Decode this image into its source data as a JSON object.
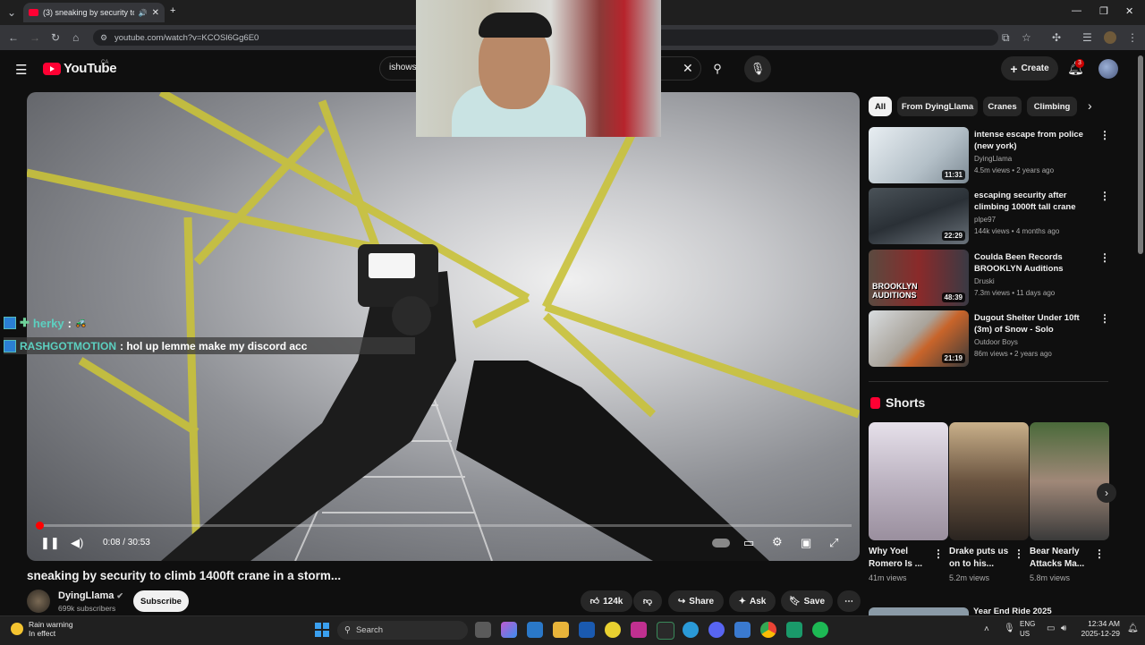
{
  "browser": {
    "tab_title": "(3) sneaking by security to",
    "url": "youtube.com/watch?v=KCOSl6Gg6E0"
  },
  "header": {
    "logo_text": "YouTube",
    "country_code": "CA",
    "search_value": "ishows",
    "create_label": "Create",
    "notification_count": "3"
  },
  "chat": {
    "line1_user": "herky",
    "line1_sep": ":",
    "line2_user": "RASHGOTMOTION",
    "line2_text": ": hol up lemme make my discord acc"
  },
  "player": {
    "time": "0:08 / 30:53",
    "progress_fraction": 0.004
  },
  "video": {
    "title": "sneaking by security to climb 1400ft crane in a storm...",
    "channel": "DyingLlama",
    "subscribers": "699k subscribers",
    "subscribe_label": "Subscribe",
    "likes": "124k",
    "share_label": "Share",
    "ask_label": "Ask",
    "save_label": "Save"
  },
  "chips": [
    "All",
    "From DyingLlama",
    "Cranes",
    "Climbing"
  ],
  "related": [
    {
      "title": "intense escape from police (new york)",
      "channel": "DyingLlama",
      "meta": "4.5m views • 2 years ago",
      "duration": "11:31"
    },
    {
      "title": "escaping security after climbing 1000ft tall crane (toronto)",
      "channel": "plpe97",
      "meta": "144k views • 4 months ago",
      "duration": "22:29"
    },
    {
      "title": "Coulda Been Records BROOKLYN Auditions hosted b...",
      "channel": "Druski",
      "meta": "7.3m views • 11 days ago",
      "duration": "48:39",
      "thumb_text": "BROOKLYN AUDITIONS"
    },
    {
      "title": "Dugout Shelter Under 10ft (3m) of Snow - Solo Camping in ...",
      "channel": "Outdoor Boys",
      "meta": "86m views • 2 years ago",
      "duration": "21:19"
    }
  ],
  "shorts": {
    "heading": "Shorts",
    "items": [
      {
        "title": "Why Yoel Romero Is ...",
        "views": "41m views"
      },
      {
        "title": "Drake puts us on to his...",
        "views": "5.2m views"
      },
      {
        "title": "Bear Nearly Attacks Ma...",
        "views": "5.8m views"
      }
    ]
  },
  "next_title": "Year End Ride 2025",
  "taskbar": {
    "weather_line1": "Rain warning",
    "weather_line2": "In effect",
    "search_placeholder": "Search",
    "lang1": "ENG",
    "lang2": "US",
    "time": "12:34 AM",
    "date": "2025-12-29"
  },
  "colors": {
    "accent_red": "#ff0033",
    "background": "#0f0f0f",
    "chip_bg": "#272727"
  }
}
